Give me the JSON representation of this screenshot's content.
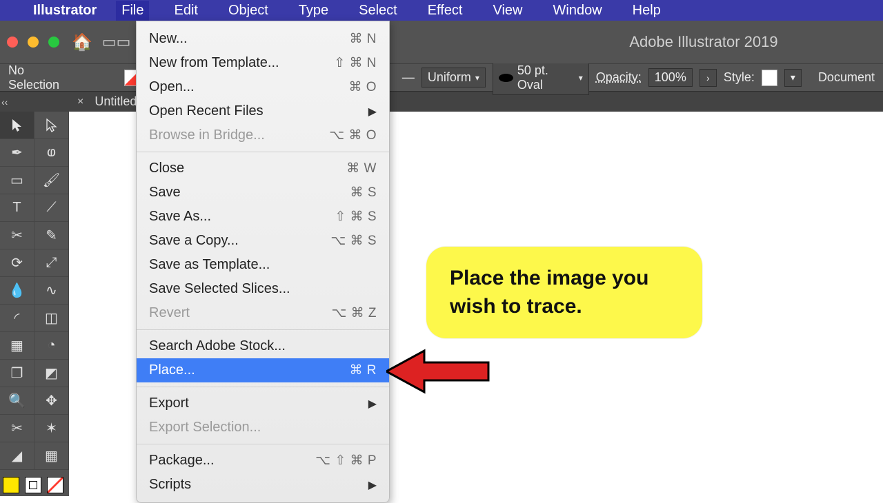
{
  "menubar": {
    "appname": "Illustrator",
    "items": [
      "File",
      "Edit",
      "Object",
      "Type",
      "Select",
      "Effect",
      "View",
      "Window",
      "Help"
    ],
    "open_index": 0
  },
  "window": {
    "title": "Adobe Illustrator 2019"
  },
  "controlbar": {
    "selection": "No Selection",
    "stroke_profile": "Uniform",
    "brush": "50 pt. Oval",
    "opacity_label": "Opacity:",
    "opacity_value": "100%",
    "style_label": "Style:",
    "doc_label": "Document"
  },
  "tab": {
    "name": "Untitled",
    "close_glyph": "×"
  },
  "file_menu": {
    "items": [
      {
        "label": "New...",
        "shortcut": "⌘ N"
      },
      {
        "label": "New from Template...",
        "shortcut": "⇧ ⌘ N"
      },
      {
        "label": "Open...",
        "shortcut": "⌘ O"
      },
      {
        "label": "Open Recent Files",
        "submenu": true
      },
      {
        "label": "Browse in Bridge...",
        "shortcut": "⌥ ⌘ O",
        "disabled": true
      },
      {
        "sep": true
      },
      {
        "label": "Close",
        "shortcut": "⌘ W"
      },
      {
        "label": "Save",
        "shortcut": "⌘ S"
      },
      {
        "label": "Save As...",
        "shortcut": "⇧ ⌘ S"
      },
      {
        "label": "Save a Copy...",
        "shortcut": "⌥ ⌘ S"
      },
      {
        "label": "Save as Template..."
      },
      {
        "label": "Save Selected Slices..."
      },
      {
        "label": "Revert",
        "shortcut": "⌥ ⌘ Z",
        "disabled": true
      },
      {
        "sep": true
      },
      {
        "label": "Search Adobe Stock..."
      },
      {
        "label": "Place...",
        "shortcut": "⌘ R",
        "highlight": true
      },
      {
        "sep": true
      },
      {
        "label": "Export",
        "submenu": true
      },
      {
        "label": "Export Selection...",
        "disabled": true
      },
      {
        "sep": true
      },
      {
        "label": "Package...",
        "shortcut": "⌥ ⇧ ⌘ P"
      },
      {
        "label": "Scripts",
        "submenu": true
      }
    ]
  },
  "annotation": {
    "text": "Place the image you wish to trace."
  },
  "tools": [
    "selection",
    "direct-selection",
    "pen",
    "curvature",
    "rectangle",
    "paintbrush",
    "type",
    "vertical-type",
    "scissors",
    "eyedropper-plus",
    "rotate",
    "reflect",
    "eyedropper",
    "blend",
    "arc",
    "shape-builder",
    "mesh",
    "pie",
    "artboard",
    "perspective",
    "zoom",
    "free-transform",
    "slice",
    "symbol-sprayer",
    "blend-tool",
    "grid"
  ]
}
